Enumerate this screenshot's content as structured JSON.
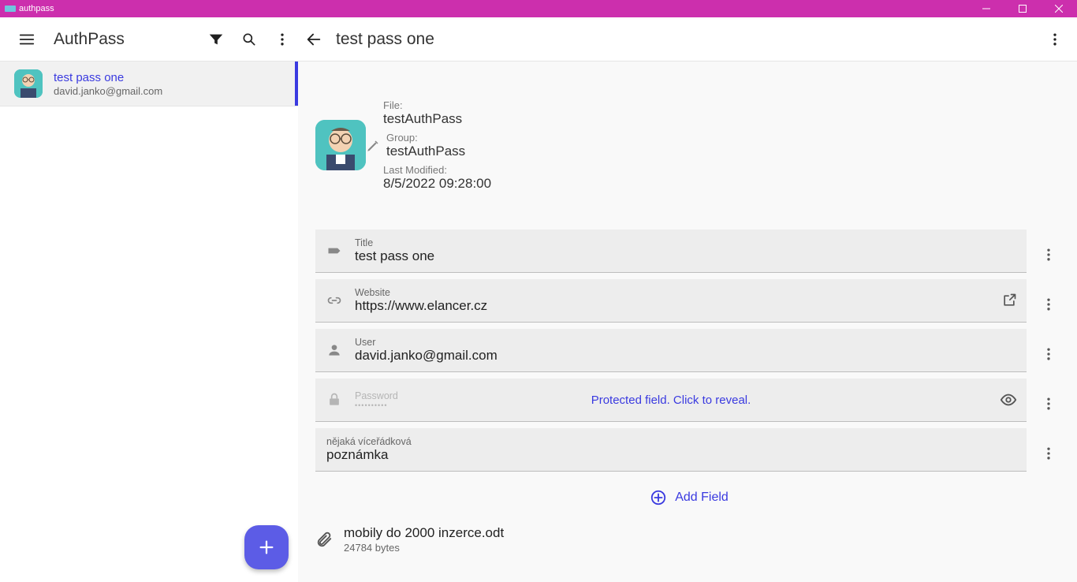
{
  "window": {
    "title": "authpass"
  },
  "header": {
    "app_title": "AuthPass",
    "entry_title": "test pass one"
  },
  "list": {
    "items": [
      {
        "title": "test pass one",
        "subtitle": "david.janko@gmail.com"
      }
    ]
  },
  "meta": {
    "file_label": "File:",
    "file_value": "testAuthPass",
    "group_label": "Group:",
    "group_value": "testAuthPass",
    "modified_label": "Last Modified:",
    "modified_value": "8/5/2022 09:28:00"
  },
  "fields": {
    "title_label": "Title",
    "title_value": "test pass one",
    "website_label": "Website",
    "website_value": "https://www.elancer.cz",
    "user_label": "User",
    "user_value": "david.janko@gmail.com",
    "password_label": "Password",
    "password_placeholder": "••••••••••",
    "password_msg": "Protected field. Click to reveal.",
    "note_label": "nějaká víceřádková",
    "note_value": "poznámka"
  },
  "actions": {
    "add_field": "Add Field"
  },
  "attachment": {
    "name": "mobily do 2000 inzerce.odt",
    "size": "24784 bytes"
  }
}
